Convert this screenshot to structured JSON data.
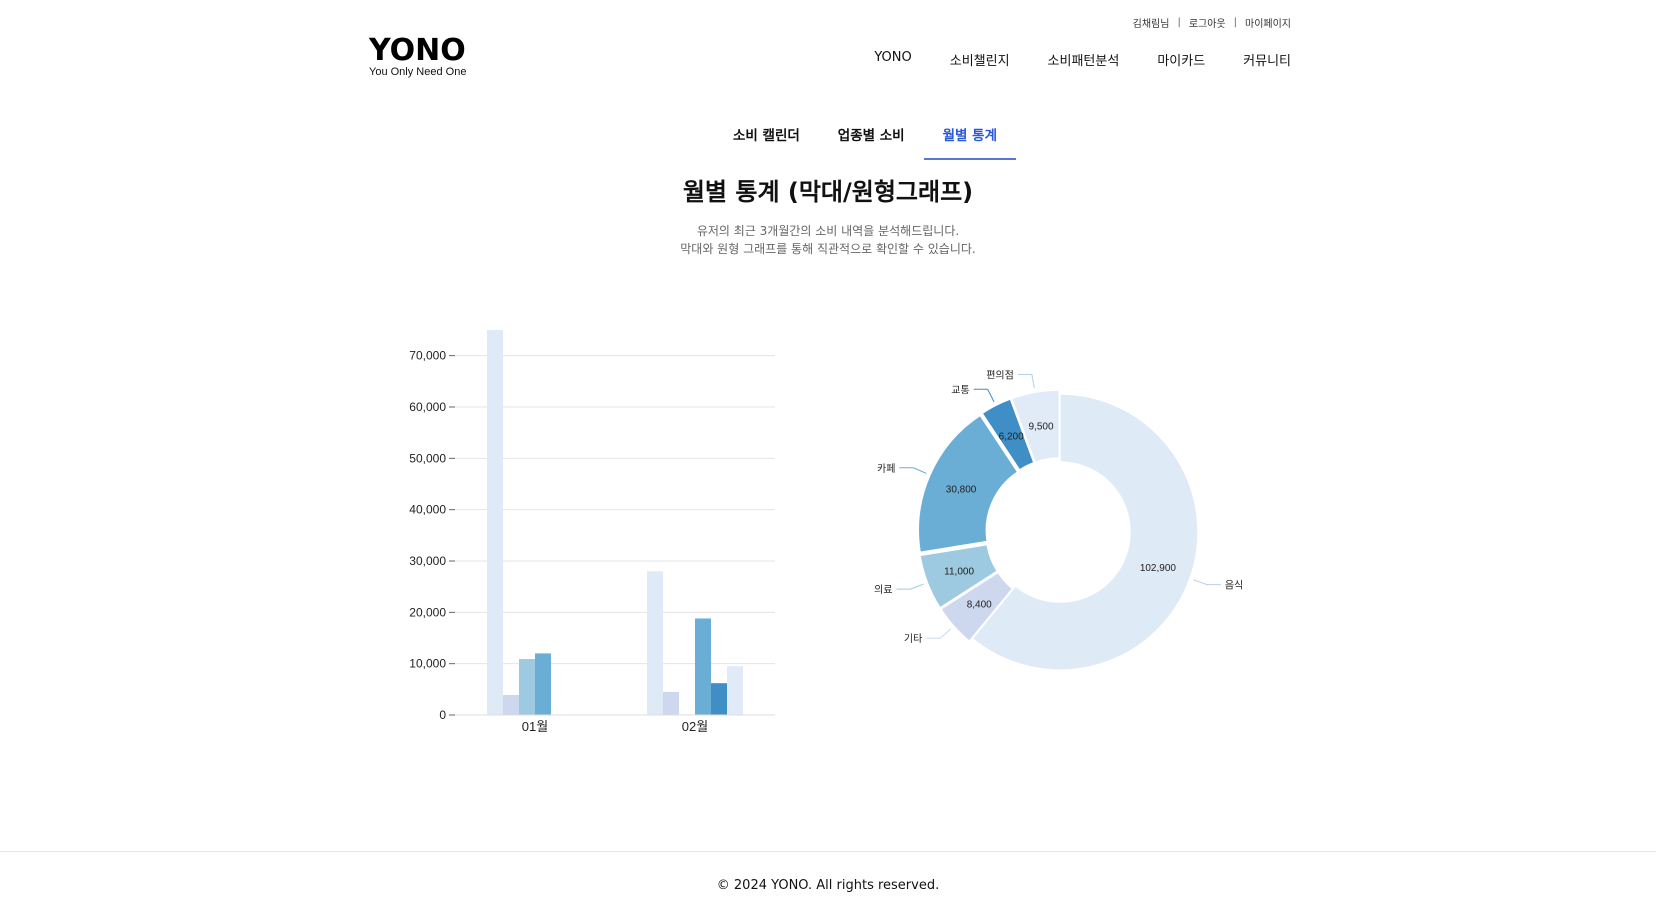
{
  "header": {
    "util_links": {
      "user": "김채림님",
      "logout": "로그아웃",
      "mypage": "마이페이지",
      "separator": "|"
    },
    "logo": {
      "main": "YONO",
      "sub": "You Only Need One"
    },
    "nav": [
      "YONO",
      "소비챌린지",
      "소비패턴분석",
      "마이카드",
      "커뮤니티"
    ]
  },
  "tabs": [
    {
      "label": "소비 캘린더",
      "active": false
    },
    {
      "label": "업종별 소비",
      "active": false
    },
    {
      "label": "월별 통계",
      "active": true
    }
  ],
  "main": {
    "title": "월별 통계 (막대/원형그래프)",
    "desc_line1": "유저의 최근 3개월간의 소비 내역을 분석해드립니다.",
    "desc_line2": "막대와 원형 그래프를 통해 직관적으로 확인할 수 있습니다."
  },
  "chart_data": [
    {
      "type": "bar",
      "categories": [
        "01월",
        "02월"
      ],
      "ylim": [
        0,
        75000
      ],
      "yticks": [
        0,
        10000,
        20000,
        30000,
        40000,
        50000,
        60000,
        70000
      ],
      "ytick_labels": [
        "0",
        "10,000",
        "20,000",
        "30,000",
        "40,000",
        "50,000",
        "60,000",
        "70,000"
      ],
      "grid": true,
      "series": [
        {
          "color": "#deeaf6",
          "values": [
            75000,
            28000
          ]
        },
        {
          "color": "#cdd8ee",
          "values": [
            3900,
            4500
          ]
        },
        {
          "color": "#9dcae0",
          "values": [
            10900,
            0
          ]
        },
        {
          "color": "#6aaed6",
          "values": [
            12000,
            18800
          ]
        },
        {
          "color": "#3f8ec6",
          "values": [
            0,
            6200
          ]
        },
        {
          "color": "#e0ebf7",
          "values": [
            0,
            9500
          ]
        }
      ]
    },
    {
      "type": "pie",
      "donut": true,
      "slices": [
        {
          "label": "음식",
          "value": 102900,
          "value_label": "102,900",
          "color": "#deeaf6"
        },
        {
          "label": "기타",
          "value": 8400,
          "value_label": "8,400",
          "color": "#cdd8ee"
        },
        {
          "label": "의료",
          "value": 11000,
          "value_label": "11,000",
          "color": "#9dcae0"
        },
        {
          "label": "카페",
          "value": 30800,
          "value_label": "30,800",
          "color": "#6aaed6"
        },
        {
          "label": "교통",
          "value": 6200,
          "value_label": "6,200",
          "color": "#3f8ec6"
        },
        {
          "label": "편의점",
          "value": 9500,
          "value_label": "9,500",
          "color": "#e0ebf7"
        }
      ]
    }
  ],
  "footer": {
    "text": "© 2024 YONO. All rights reserved."
  }
}
